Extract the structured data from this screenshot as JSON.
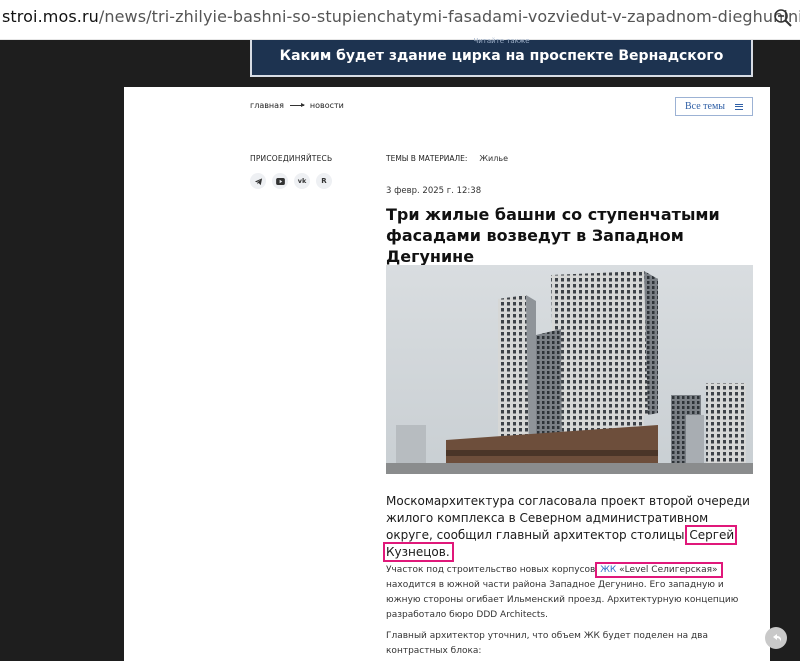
{
  "browser": {
    "url_domain": "stroi.mos.ru",
    "url_path": "/news/tri-zhilyie-bashni-so-stupienchatymi-fasadami-vozviedut-v-zapadnom-dieghuninie",
    "zoom_icon": "zoom-out-icon"
  },
  "banner": {
    "tiny_text": "Читайте также",
    "title": "Каким будет здание цирка на проспекте Вернадского",
    "bg_color": "#1d3350"
  },
  "breadcrumb": {
    "home": "главная",
    "current": "новости"
  },
  "themes_button": {
    "label": "Все темы"
  },
  "sidebar": {
    "join_title": "ПРИСОЕДИНЯЙТЕСЬ",
    "socials": [
      {
        "name": "telegram-icon",
        "glyph": "✈"
      },
      {
        "name": "youtube-icon",
        "glyph": "▶"
      },
      {
        "name": "vk-icon",
        "glyph": "vk"
      },
      {
        "name": "rutube-icon",
        "glyph": "R"
      }
    ]
  },
  "article": {
    "tags_label": "ТЕМЫ В МАТЕРИАЛЕ:",
    "tag": "Жилье",
    "date": "3 февр. 2025 г.  12:38",
    "headline": "Три жилые башни со ступенчатыми фасадами возведут в Западном Дегунине",
    "lead_before": "Москомархитектура согласовала проект второй очереди жилого комплекса в Северном административном округе, сообщил главный архитектор столицы ",
    "lead_highlight": "Сергей Кузнецов.",
    "p1_before": "Участок под строительство новых корпусов ",
    "p1_link": "ЖК",
    "p1_link_rest": " «Level Селигерская»",
    "p1_after": " находится в южной части района Западное Дегунино. Его западную и южную стороны огибает Ильменский проезд. Архитектурную концепцию разработало бюро DDD Architects.",
    "p2": "Главный архитектор уточнил, что объем ЖК будет поделен на два контрастных блока:",
    "highlight_color": "#e0187a",
    "link_color": "#2d6cc6"
  }
}
